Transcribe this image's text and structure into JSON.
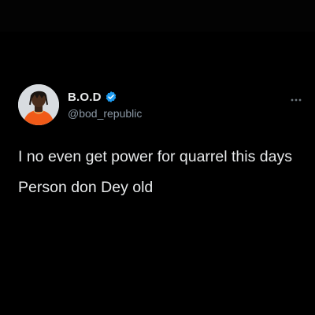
{
  "tweet": {
    "author": {
      "display_name": "B.O.D",
      "handle": "@bod_republic",
      "verified": true
    },
    "text_lines": [
      "I no even get power for quarrel this days",
      "Person don Dey old"
    ],
    "more_icon": "more-horizontal-icon",
    "verified_icon": "verified-badge-icon"
  },
  "colors": {
    "background": "#000000",
    "text_primary": "#e7e9ea",
    "text_secondary": "#8b98a5",
    "verified_blue": "#1d9bf0",
    "avatar_shirt": "#f05a18"
  }
}
